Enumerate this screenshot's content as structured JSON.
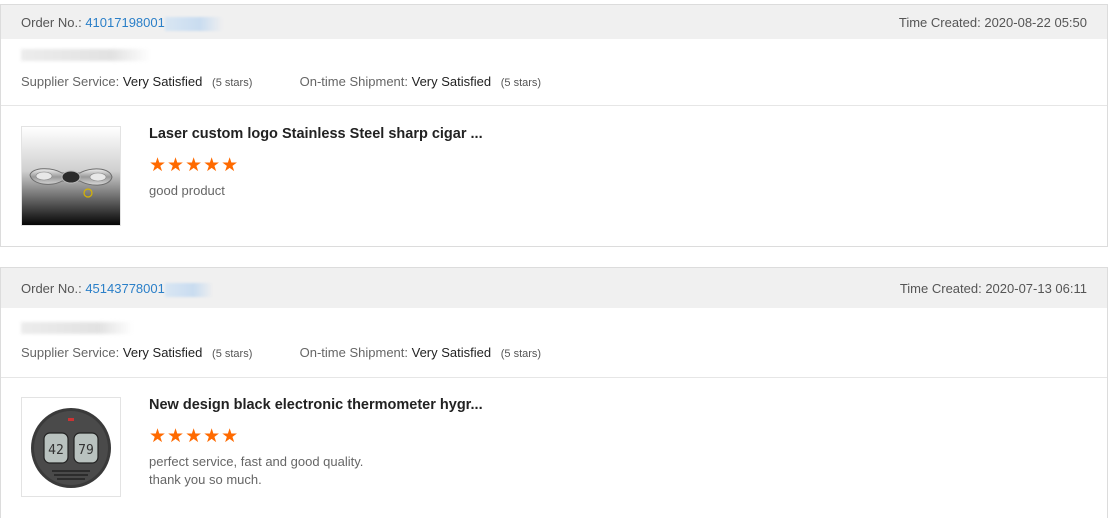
{
  "reviews": [
    {
      "order_label": "Order No.:",
      "order_number": "41017198001",
      "time_created": "Time Created: 2020-08-22 05:50",
      "supplier_service_label": "Supplier Service:",
      "supplier_service_value": "Very Satisfied",
      "supplier_service_stars": "(5 stars)",
      "shipment_label": "On-time Shipment:",
      "shipment_value": "Very Satisfied",
      "shipment_stars": "(5 stars)",
      "product_title": "Laser custom logo Stainless Steel sharp cigar ...",
      "rating": 5,
      "stars": "★★★★★",
      "review_lines": [
        "good product"
      ]
    },
    {
      "order_label": "Order No.:",
      "order_number": "45143778001",
      "time_created": "Time Created: 2020-07-13 06:11",
      "supplier_service_label": "Supplier Service:",
      "supplier_service_value": "Very Satisfied",
      "supplier_service_stars": "(5 stars)",
      "shipment_label": "On-time Shipment:",
      "shipment_value": "Very Satisfied",
      "shipment_stars": "(5 stars)",
      "product_title": "New design black electronic thermometer hygr...",
      "rating": 5,
      "stars": "★★★★★",
      "review_lines": [
        "perfect service, fast and good quality.",
        "thank you so much."
      ]
    }
  ],
  "thermo": {
    "left_reading": "42",
    "right_reading": "79"
  },
  "colors": {
    "link": "#2a7fc8",
    "star": "#ff6a00",
    "header_bg": "#f0f0f0"
  }
}
